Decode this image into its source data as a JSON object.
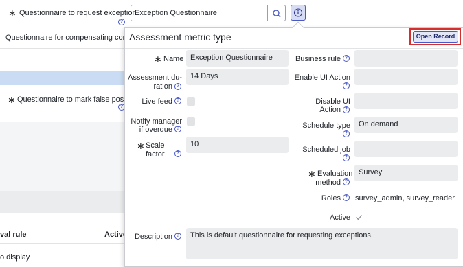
{
  "top": {
    "exception_label": "Questionnaire to request exception",
    "exception_value": "Exception Questionnaire",
    "compensating_label": "Questionnaire for compensating contro",
    "false_positive_label": "Questionnaire to mark false positive",
    "table_col1": "val rule",
    "table_col2": "Active",
    "no_records": "o display"
  },
  "popup": {
    "title": "Assessment metric type",
    "open_record": "Open Record",
    "name_label": "Name",
    "name_value": "Exception Questionnaire",
    "duration_label_1": "Assessment du-",
    "duration_label_2": "ration",
    "duration_value": "14 Days",
    "live_feed_label": "Live feed",
    "notify_label_1": "Notify manager",
    "notify_label_2": "if overdue",
    "scale_label": "Scale factor",
    "scale_value": "10",
    "description_label": "Description",
    "description_value": "This is default questionnaire for requesting exceptions.",
    "business_rule_label": "Business rule",
    "business_rule_value": "",
    "enable_ui_label_1": "Enable UI Action",
    "enable_ui_value": "",
    "disable_ui_label_1": "Disable UI",
    "disable_ui_label_2": "Action",
    "disable_ui_value": "",
    "schedule_type_label": "Schedule type",
    "schedule_type_value": "On demand",
    "scheduled_job_label": "Scheduled job",
    "scheduled_job_value": "",
    "eval_label_1": "Evaluation",
    "eval_label_2": "method",
    "eval_value": "Survey",
    "roles_label": "Roles",
    "roles_value": "survey_admin, survey_reader",
    "active_label": "Active"
  },
  "icons": {
    "search": "search-icon",
    "info": "info-icon",
    "help": "help-icon",
    "required": "required-star-icon",
    "check": "checkmark-icon"
  },
  "colors": {
    "accent": "#4a59c6",
    "highlight_border": "#d62d2d",
    "field_bg": "#ebeced",
    "selected_row": "#c9dcf3"
  }
}
